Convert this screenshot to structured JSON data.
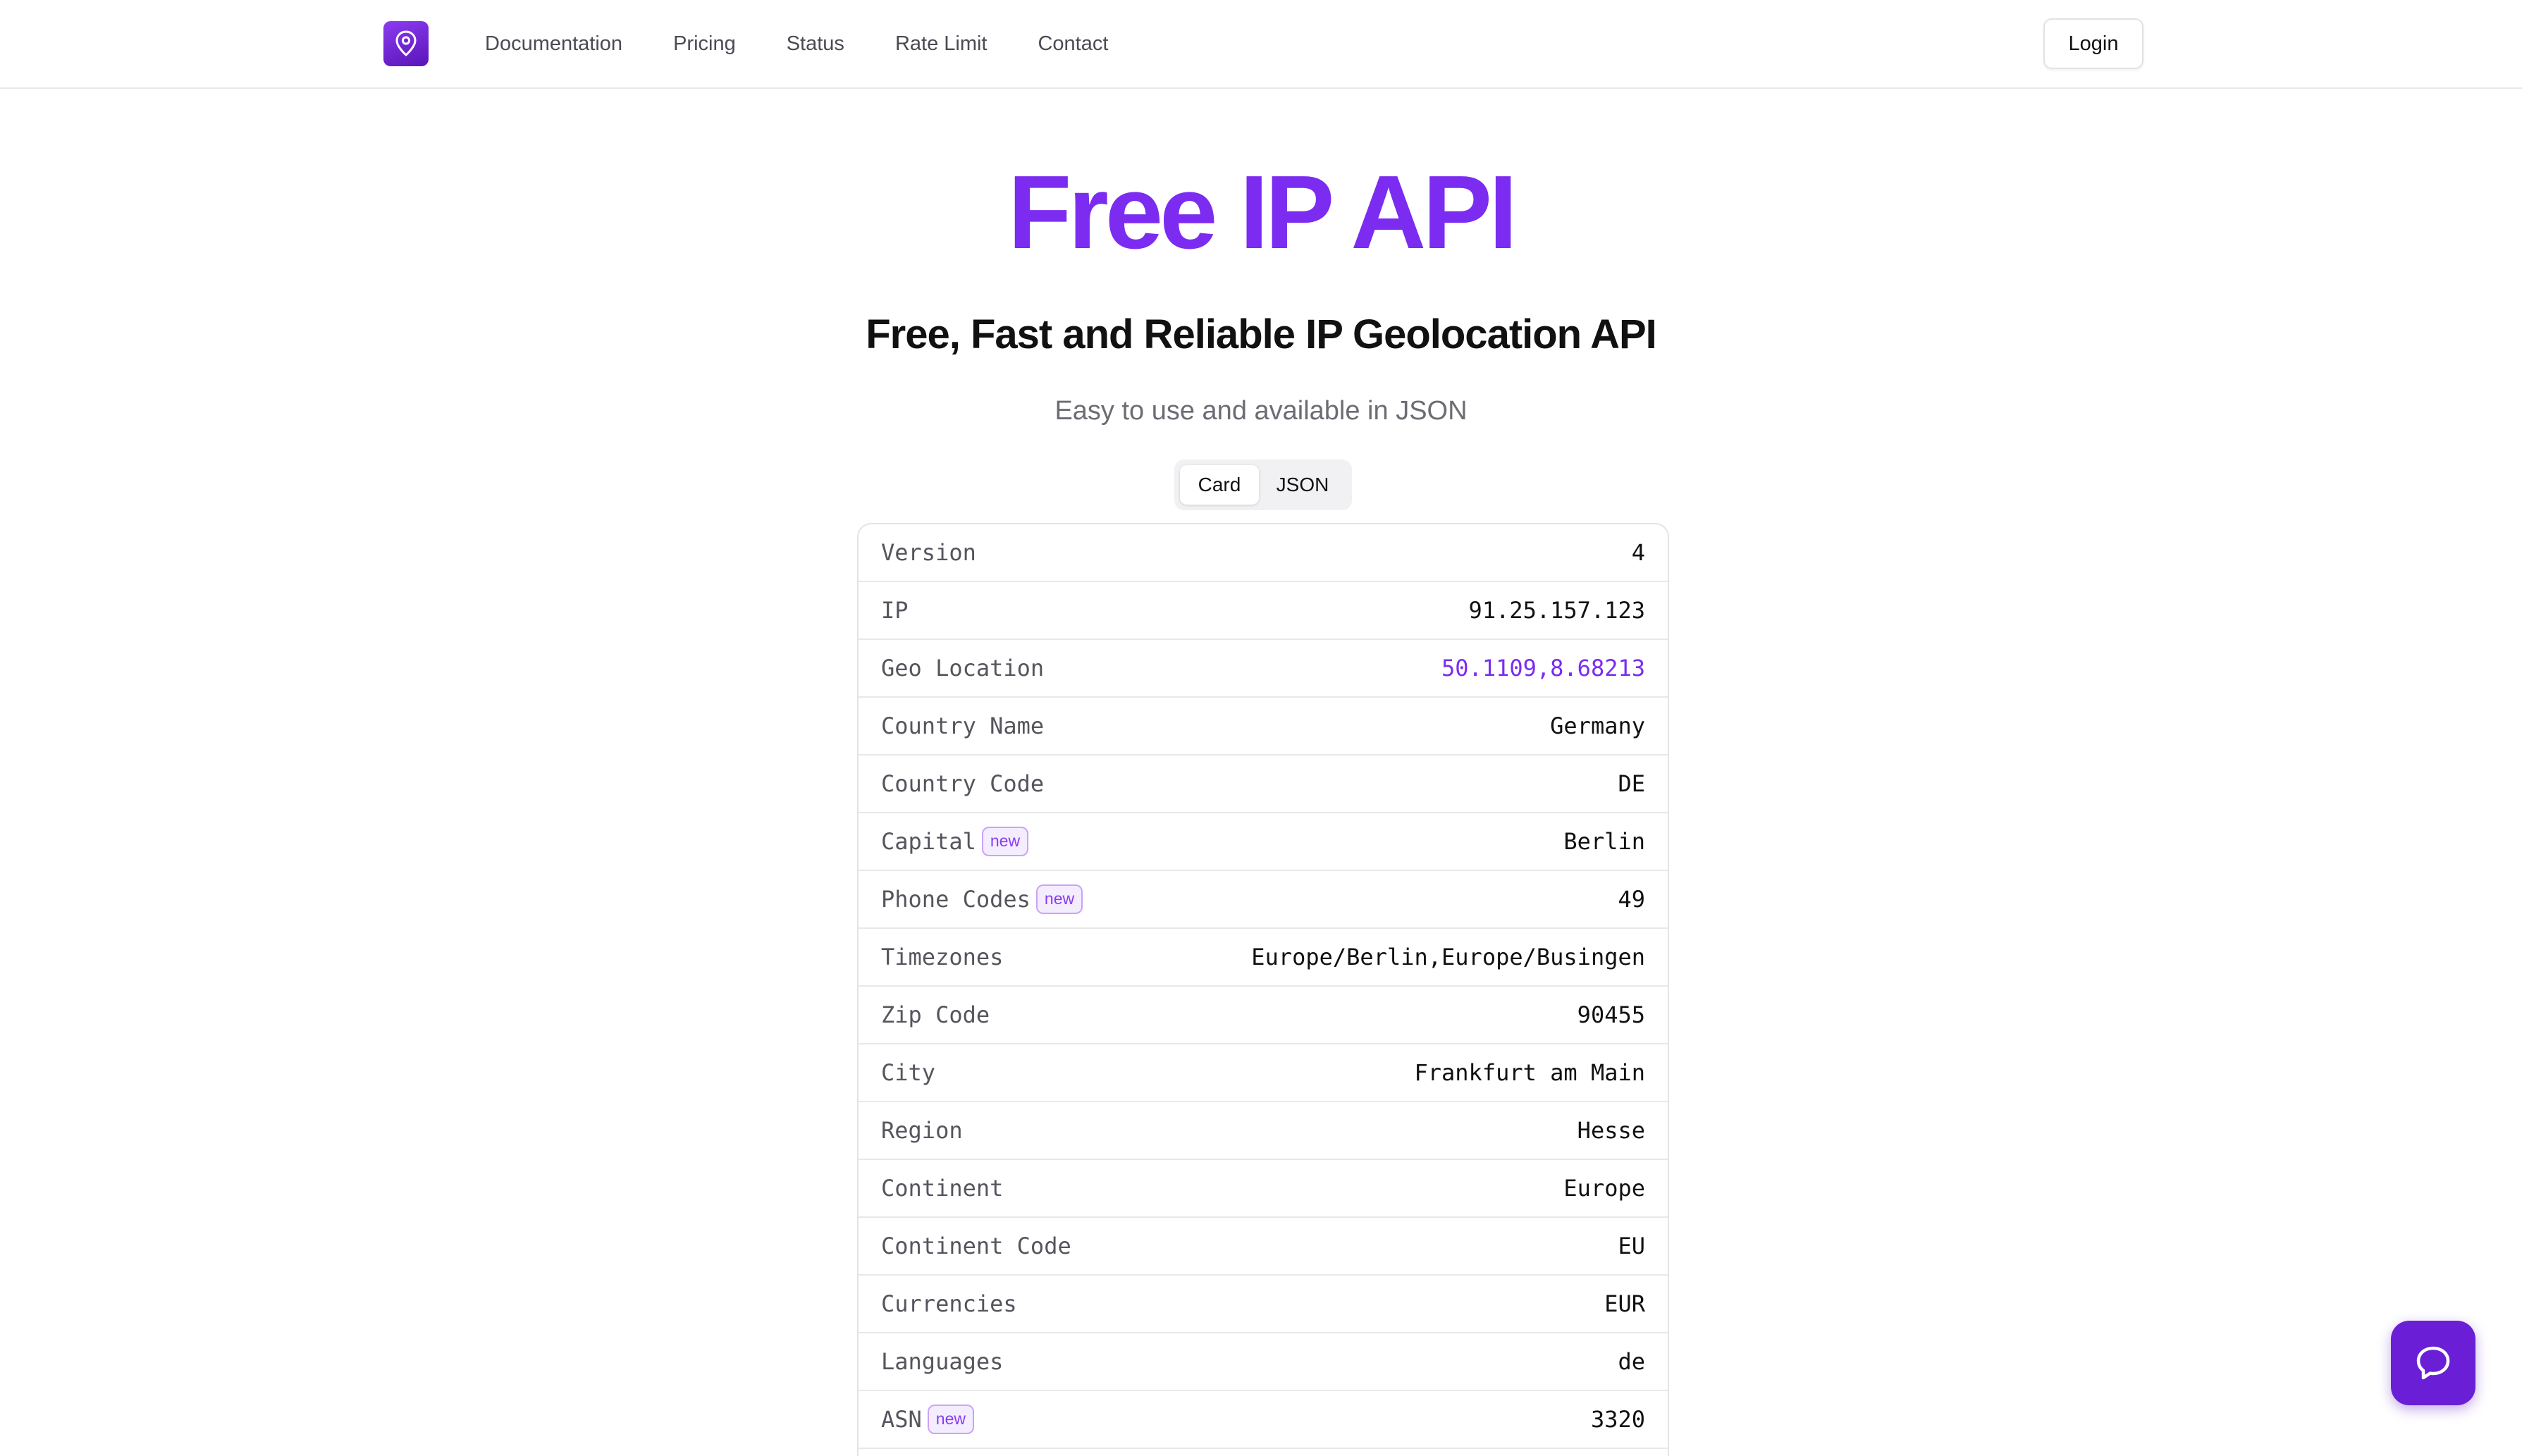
{
  "nav": {
    "logo_icon": "map-pin-icon",
    "links": [
      "Documentation",
      "Pricing",
      "Status",
      "Rate Limit",
      "Contact"
    ],
    "login_label": "Login"
  },
  "hero": {
    "title": "Free IP API",
    "subtitle": "Free, Fast and Reliable IP Geolocation API",
    "tagline": "Easy to use and available in JSON"
  },
  "view_toggle": {
    "options": [
      "Card",
      "JSON"
    ],
    "selected": "Card"
  },
  "info_rows": [
    {
      "key": "Version",
      "value": "4",
      "badge": ""
    },
    {
      "key": "IP",
      "value": "91.25.157.123",
      "badge": ""
    },
    {
      "key": "Geo Location",
      "value": "50.1109,8.68213",
      "badge": "",
      "link": true
    },
    {
      "key": "Country Name",
      "value": "Germany",
      "badge": ""
    },
    {
      "key": "Country Code",
      "value": "DE",
      "badge": ""
    },
    {
      "key": "Capital",
      "value": "Berlin",
      "badge": "new"
    },
    {
      "key": "Phone Codes",
      "value": "49",
      "badge": "new"
    },
    {
      "key": "Timezones",
      "value": "Europe/Berlin,Europe/Busingen",
      "badge": ""
    },
    {
      "key": "Zip Code",
      "value": "90455",
      "badge": ""
    },
    {
      "key": "City",
      "value": "Frankfurt am Main",
      "badge": ""
    },
    {
      "key": "Region",
      "value": "Hesse",
      "badge": ""
    },
    {
      "key": "Continent",
      "value": "Europe",
      "badge": ""
    },
    {
      "key": "Continent Code",
      "value": "EU",
      "badge": ""
    },
    {
      "key": "Currencies",
      "value": "EUR",
      "badge": ""
    },
    {
      "key": "Languages",
      "value": "de",
      "badge": ""
    },
    {
      "key": "ASN",
      "value": "3320",
      "badge": "new"
    }
  ],
  "colors": {
    "accent": "#7b2cf0",
    "chat_button": "#6a1fd6"
  },
  "chat": {
    "icon": "chat-bubble-icon"
  }
}
